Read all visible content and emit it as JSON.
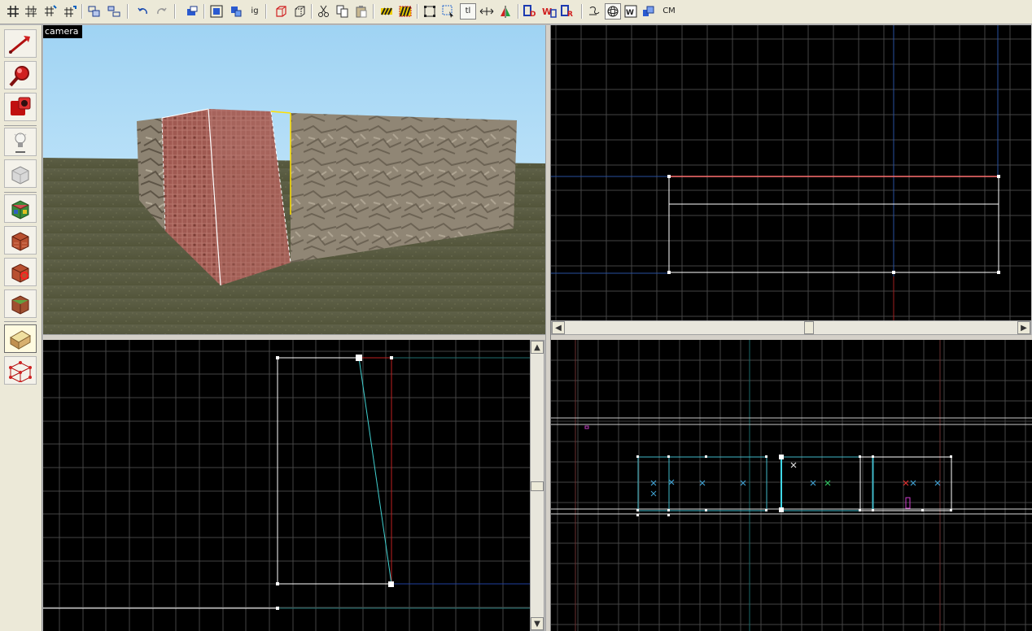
{
  "camera_view": {
    "label": "camera"
  },
  "toolbar": {
    "identity_text": "ig",
    "tl_text": "tl",
    "cm_text": "CM"
  },
  "colors": {
    "grid_line": "#555555",
    "brush_outline": "#ffffff",
    "selected_edge": "#ff4444",
    "cyan_edge": "#40d0d0",
    "sky": "#a8d8f4",
    "ground": "#5a5a3a"
  },
  "icons": {
    "toolbar": [
      "grid-icon",
      "3d-grid-icon",
      "grid-small-icon",
      "grid-large-icon",
      "group-icon",
      "ungroup-icon",
      "undo-icon",
      "redo-icon",
      "carve-icon",
      "hollow-icon",
      "paste-special-icon",
      "cut-icon",
      "copy-icon",
      "paste-icon",
      "hazard-icon",
      "hazard-select-icon",
      "select-box-icon",
      "select-lasso-icon",
      "align-left-icon",
      "flip-icon",
      "axis-icon",
      "texture-lock-icon",
      "texture-wrap-icon",
      "texture-browser-icon",
      "ghost-icon",
      "sphere-icon",
      "entity-icon",
      "map-icon"
    ],
    "tools": [
      "selection-tool-icon",
      "magnify-tool-icon",
      "camera-tool-icon",
      "entity-tool-icon",
      "block-tool-icon",
      "texture-tool-icon",
      "apply-texture-icon",
      "decal-tool-icon",
      "overlay-tool-icon",
      "clip-tool-icon",
      "vertex-tool-icon"
    ]
  }
}
